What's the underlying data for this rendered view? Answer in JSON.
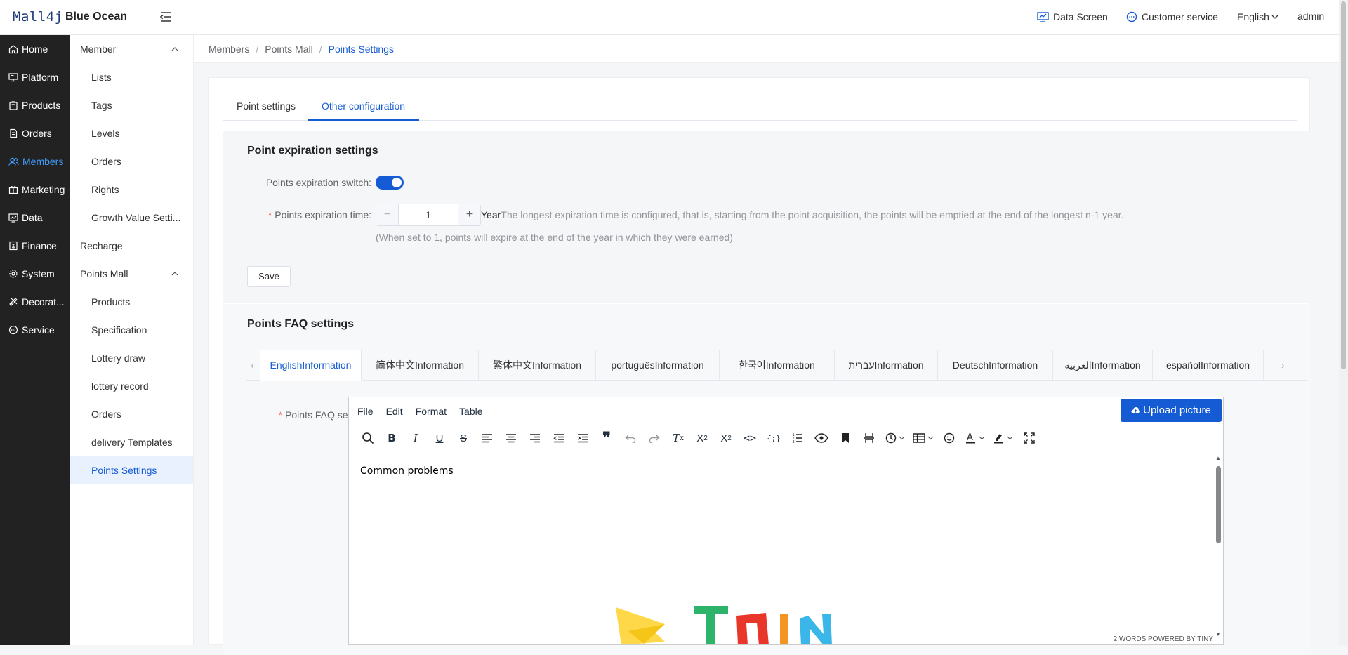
{
  "header": {
    "logo": "Mall4j",
    "brand": "Blue Ocean",
    "data_screen": "Data Screen",
    "customer_service": "Customer service",
    "language": "English",
    "user": "admin"
  },
  "main_nav": [
    {
      "label": "Home",
      "icon": "home-icon"
    },
    {
      "label": "Platform",
      "icon": "monitor-icon"
    },
    {
      "label": "Products",
      "icon": "bag-icon"
    },
    {
      "label": "Orders",
      "icon": "document-icon"
    },
    {
      "label": "Members",
      "icon": "users-icon",
      "active": true
    },
    {
      "label": "Marketing",
      "icon": "gift-icon"
    },
    {
      "label": "Data",
      "icon": "chart-icon"
    },
    {
      "label": "Finance",
      "icon": "finance-icon"
    },
    {
      "label": "System",
      "icon": "gear-icon"
    },
    {
      "label": "Decorat...",
      "icon": "palette-icon"
    },
    {
      "label": "Service",
      "icon": "chat-icon"
    }
  ],
  "sub_nav": {
    "member_group": "Member",
    "member_items": [
      "Lists",
      "Tags",
      "Levels",
      "Orders",
      "Rights",
      "Growth Value Setti..."
    ],
    "recharge": "Recharge",
    "points_group": "Points Mall",
    "points_items": [
      "Products",
      "Specification",
      "Lottery draw",
      "lottery record",
      "Orders",
      "delivery Templates",
      "Points Settings"
    ]
  },
  "breadcrumb": [
    "Members",
    "Points Mall",
    "Points Settings"
  ],
  "tabs": [
    "Point settings",
    "Other configuration"
  ],
  "expiration": {
    "title": "Point expiration settings",
    "switch_label": "Points expiration switch:",
    "switch_on": true,
    "time_label": "Points expiration time:",
    "time_value": "1",
    "unit": "Year",
    "hint": "The longest expiration time is configured, that is, starting from the point acquisition, the points will be emptied at the end of the longest n-1 year.",
    "note": "(When set to 1, points will expire at the end of the year in which they were earned)",
    "save": "Save"
  },
  "faq": {
    "title": "Points FAQ settings",
    "label": "Points FAQ settings",
    "languages": [
      "EnglishInformation",
      "简体中文Information",
      "繁体中文Information",
      "portuguêsInformation",
      "한국어Information",
      "עבריתInformation",
      "DeutschInformation",
      "العربيةInformation",
      "españolInformation"
    ]
  },
  "editor": {
    "menus": [
      "File",
      "Edit",
      "Format",
      "Table"
    ],
    "upload": "Upload picture",
    "content": "Common problems",
    "status": "2 WORDS  POWERED BY TINY"
  }
}
